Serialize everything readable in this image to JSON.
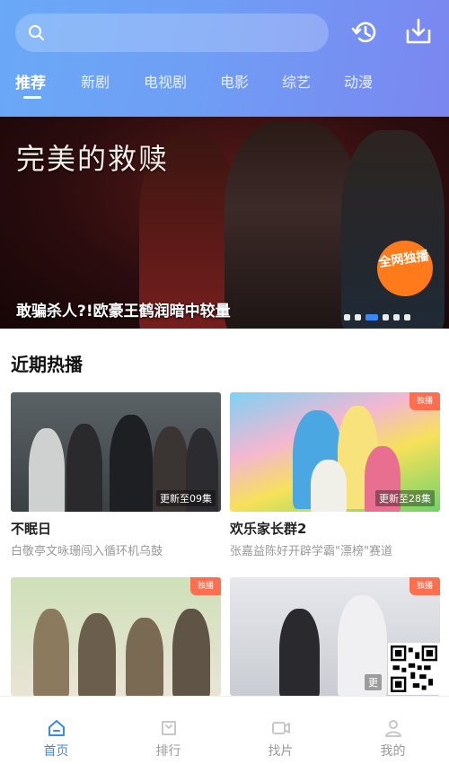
{
  "header": {
    "search_placeholder": "",
    "tabs": [
      {
        "label": "推荐",
        "active": true
      },
      {
        "label": "新剧",
        "active": false
      },
      {
        "label": "电视剧",
        "active": false
      },
      {
        "label": "电影",
        "active": false
      },
      {
        "label": "综艺",
        "active": false
      },
      {
        "label": "动漫",
        "active": false
      }
    ]
  },
  "banner": {
    "title": "完美的救赎",
    "badge": "全网独播",
    "caption": "敢骗杀人?!欧豪王鹤润暗中较量",
    "slide_count": 6,
    "active_slide": 3
  },
  "section": {
    "title": "近期热播"
  },
  "cards": [
    {
      "name": "不眠日",
      "desc": "白敬亭文咏珊闯入循环机乌鼓",
      "update": "更新至09集",
      "corner": ""
    },
    {
      "name": "欢乐家长群2",
      "desc": "张嘉益陈好开辟学霸\"漂榜\"赛道",
      "update": "更新至28集",
      "corner": "独播"
    },
    {
      "name": "",
      "desc": "",
      "update": "",
      "corner": "独播"
    },
    {
      "name": "",
      "desc": "",
      "update": "更",
      "corner": "独播"
    }
  ],
  "bottom_nav": [
    {
      "label": "首页",
      "icon": "home-icon",
      "active": true
    },
    {
      "label": "排行",
      "icon": "ranking-icon",
      "active": false
    },
    {
      "label": "找片",
      "icon": "video-icon",
      "active": false
    },
    {
      "label": "我的",
      "icon": "user-icon",
      "active": false
    }
  ],
  "colors": {
    "accent": "#3b87f5",
    "header_gradient_start": "#6aa9f7",
    "header_gradient_end": "#7b86f0",
    "badge_orange": "#ff7a1a"
  }
}
